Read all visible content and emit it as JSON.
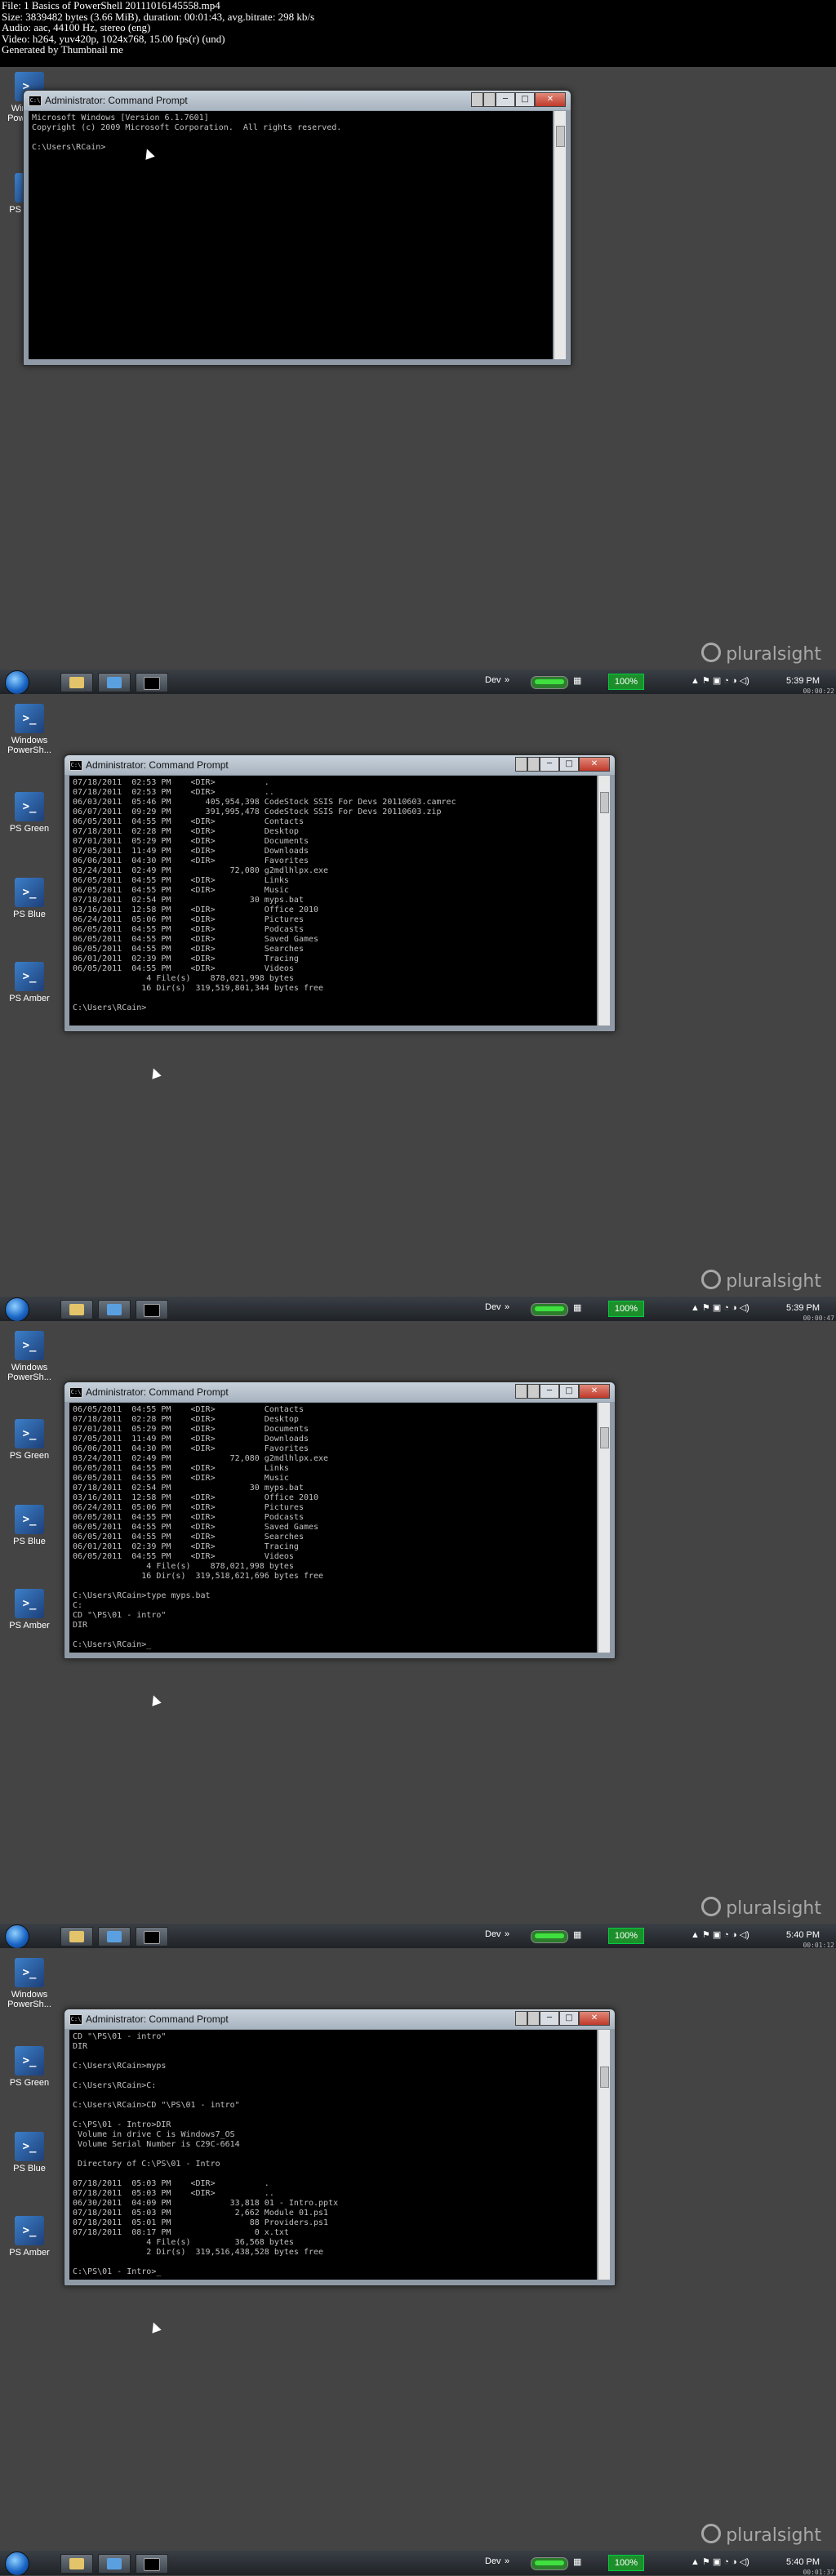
{
  "header": {
    "file": "File: 1 Basics of PowerShell 20111016145558.mp4",
    "size": "Size: 3839482 bytes (3.66 MiB), duration: 00:01:43, avg.bitrate: 298 kb/s",
    "audio": "Audio: aac, 44100 Hz, stereo (eng)",
    "video": "Video: h264, yuv420p, 1024x768, 15.00 fps(r) (und)",
    "generated": "Generated by Thumbnail me"
  },
  "desktop_icons": {
    "windows_powershell": "Windows PowerSh...",
    "ps_green": "PS Green",
    "ps_blue": "PS Blue",
    "ps_amber": "PS Amber"
  },
  "window": {
    "title": "Administrator: Command Prompt",
    "min": "─",
    "max": "□",
    "close": "✕"
  },
  "frames": [
    {
      "console": "Microsoft Windows [Version 6.1.7601]\nCopyright (c) 2009 Microsoft Corporation.  All rights reserved.\n\nC:\\Users\\RCain>",
      "time": "5:39 PM",
      "timestamp": "00:00:22"
    },
    {
      "console": "07/18/2011  02:53 PM    <DIR>          .\n07/18/2011  02:53 PM    <DIR>          ..\n06/03/2011  05:46 PM       405,954,398 CodeStock SSIS For Devs 20110603.camrec\n06/07/2011  09:29 PM       391,995,478 CodeStock SSIS For Devs 20110603.zip\n06/05/2011  04:55 PM    <DIR>          Contacts\n07/18/2011  02:28 PM    <DIR>          Desktop\n07/01/2011  05:29 PM    <DIR>          Documents\n07/05/2011  11:49 PM    <DIR>          Downloads\n06/06/2011  04:30 PM    <DIR>          Favorites\n03/24/2011  02:49 PM            72,080 g2mdlhlpx.exe\n06/05/2011  04:55 PM    <DIR>          Links\n06/05/2011  04:55 PM    <DIR>          Music\n07/18/2011  02:54 PM                30 myps.bat\n03/16/2011  12:58 PM    <DIR>          Office 2010\n06/24/2011  05:06 PM    <DIR>          Pictures\n06/05/2011  04:55 PM    <DIR>          Podcasts\n06/05/2011  04:55 PM    <DIR>          Saved Games\n06/05/2011  04:55 PM    <DIR>          Searches\n06/01/2011  02:39 PM    <DIR>          Tracing\n06/05/2011  04:55 PM    <DIR>          Videos\n               4 File(s)    878,021,998 bytes\n              16 Dir(s)  319,519,801,344 bytes free\n\nC:\\Users\\RCain>",
      "time": "5:39 PM",
      "timestamp": "00:00:47"
    },
    {
      "console": "06/05/2011  04:55 PM    <DIR>          Contacts\n07/18/2011  02:28 PM    <DIR>          Desktop\n07/01/2011  05:29 PM    <DIR>          Documents\n07/05/2011  11:49 PM    <DIR>          Downloads\n06/06/2011  04:30 PM    <DIR>          Favorites\n03/24/2011  02:49 PM            72,080 g2mdlhlpx.exe\n06/05/2011  04:55 PM    <DIR>          Links\n06/05/2011  04:55 PM    <DIR>          Music\n07/18/2011  02:54 PM                30 myps.bat\n03/16/2011  12:58 PM    <DIR>          Office 2010\n06/24/2011  05:06 PM    <DIR>          Pictures\n06/05/2011  04:55 PM    <DIR>          Podcasts\n06/05/2011  04:55 PM    <DIR>          Saved Games\n06/05/2011  04:55 PM    <DIR>          Searches\n06/01/2011  02:39 PM    <DIR>          Tracing\n06/05/2011  04:55 PM    <DIR>          Videos\n               4 File(s)    878,021,998 bytes\n              16 Dir(s)  319,518,621,696 bytes free\n\nC:\\Users\\RCain>type myps.bat\nC:\nCD \"\\PS\\01 - intro\"\nDIR\n\nC:\\Users\\RCain>_",
      "time": "5:40 PM",
      "timestamp": "00:01:12"
    },
    {
      "console": "CD \"\\PS\\01 - intro\"\nDIR\n\nC:\\Users\\RCain>myps\n\nC:\\Users\\RCain>C:\n\nC:\\Users\\RCain>CD \"\\PS\\01 - intro\"\n\nC:\\PS\\01 - Intro>DIR\n Volume in drive C is Windows7_OS\n Volume Serial Number is C29C-6614\n\n Directory of C:\\PS\\01 - Intro\n\n07/18/2011  05:03 PM    <DIR>          .\n07/18/2011  05:03 PM    <DIR>          ..\n06/30/2011  04:09 PM            33,818 01 - Intro.pptx\n07/18/2011  05:03 PM             2,662 Module 01.ps1\n07/18/2011  05:01 PM                88 Providers.ps1\n07/18/2011  08:17 PM                 0 x.txt\n               4 File(s)         36,568 bytes\n               2 Dir(s)  319,516,438,528 bytes free\n\nC:\\PS\\01 - Intro>_",
      "time": "5:40 PM",
      "timestamp": "00:01:37"
    }
  ],
  "taskbar": {
    "dev_label": "Dev",
    "more": "»",
    "battery_pct": "100%"
  },
  "logo": "pluralsight"
}
